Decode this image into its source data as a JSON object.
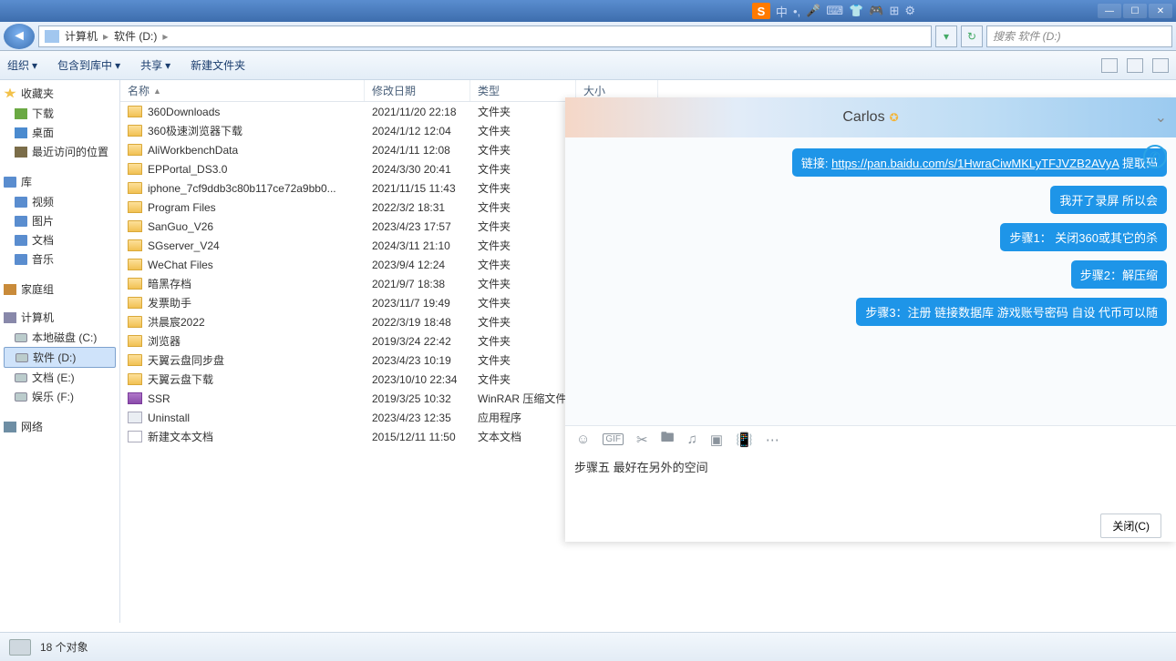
{
  "ime": {
    "lang": "中"
  },
  "window_controls": {
    "min": "—",
    "max": "☐",
    "close": "✕"
  },
  "breadcrumb": {
    "root": "计算机",
    "drive": "软件 (D:)"
  },
  "search": {
    "placeholder": "搜索 软件 (D:)"
  },
  "toolbar": {
    "organize": "组织",
    "include": "包含到库中",
    "share": "共享",
    "newfolder": "新建文件夹"
  },
  "sidebar": {
    "fav": "收藏夹",
    "dl": "下载",
    "desk": "桌面",
    "recent": "最近访问的位置",
    "lib": "库",
    "video": "视频",
    "pic": "图片",
    "doc": "文档",
    "music": "音乐",
    "home": "家庭组",
    "comp": "计算机",
    "c": "本地磁盘 (C:)",
    "d": "软件 (D:)",
    "e": "文档 (E:)",
    "f": "娱乐 (F:)",
    "net": "网络"
  },
  "columns": {
    "name": "名称",
    "date": "修改日期",
    "type": "类型",
    "size": "大小"
  },
  "rows": [
    {
      "name": "360Downloads",
      "date": "2021/11/20 22:18",
      "type": "文件夹",
      "ic": "folder"
    },
    {
      "name": "360极速浏览器下载",
      "date": "2024/1/12 12:04",
      "type": "文件夹",
      "ic": "folder"
    },
    {
      "name": "AliWorkbenchData",
      "date": "2024/1/11 12:08",
      "type": "文件夹",
      "ic": "folder"
    },
    {
      "name": "EPPortal_DS3.0",
      "date": "2024/3/30 20:41",
      "type": "文件夹",
      "ic": "folder"
    },
    {
      "name": "iphone_7cf9ddb3c80b117ce72a9bb0...",
      "date": "2021/11/15 11:43",
      "type": "文件夹",
      "ic": "folder"
    },
    {
      "name": "Program Files",
      "date": "2022/3/2 18:31",
      "type": "文件夹",
      "ic": "folder"
    },
    {
      "name": "SanGuo_V26",
      "date": "2023/4/23 17:57",
      "type": "文件夹",
      "ic": "folder"
    },
    {
      "name": "SGserver_V24",
      "date": "2024/3/11 21:10",
      "type": "文件夹",
      "ic": "folder"
    },
    {
      "name": "WeChat Files",
      "date": "2023/9/4 12:24",
      "type": "文件夹",
      "ic": "folder"
    },
    {
      "name": "暗黑存档",
      "date": "2021/9/7 18:38",
      "type": "文件夹",
      "ic": "folder"
    },
    {
      "name": "发票助手",
      "date": "2023/11/7 19:49",
      "type": "文件夹",
      "ic": "folder"
    },
    {
      "name": "洪晨宸2022",
      "date": "2022/3/19 18:48",
      "type": "文件夹",
      "ic": "folder"
    },
    {
      "name": "浏览器",
      "date": "2019/3/24 22:42",
      "type": "文件夹",
      "ic": "folder"
    },
    {
      "name": "天翼云盘同步盘",
      "date": "2023/4/23 10:19",
      "type": "文件夹",
      "ic": "folder"
    },
    {
      "name": "天翼云盘下载",
      "date": "2023/10/10 22:34",
      "type": "文件夹",
      "ic": "folder"
    },
    {
      "name": "SSR",
      "date": "2019/3/25 10:32",
      "type": "WinRAR 压缩文件",
      "ic": "rar"
    },
    {
      "name": "Uninstall",
      "date": "2023/4/23 12:35",
      "type": "应用程序",
      "ic": "exe"
    },
    {
      "name": "新建文本文档",
      "date": "2015/12/11 11:50",
      "type": "文本文档",
      "ic": "txt"
    }
  ],
  "status": "18 个对象",
  "chat": {
    "title": "Carlos",
    "link_label": "链接: ",
    "link_url": "https://pan.baidu.com/s/1HwraCiwMKLyTFJVZB2AVyA",
    "link_tail": " 提取码",
    "m2": "我开了录屏 所以会",
    "m3": "步骤1： 关闭360或其它的杀",
    "m4": "步骤2：解压缩",
    "m5": "步骤3：注册  链接数据库  游戏账号密码 自设  代币可以随",
    "input": "步骤五 最好在另外的空间",
    "close": "关闭(C)"
  }
}
